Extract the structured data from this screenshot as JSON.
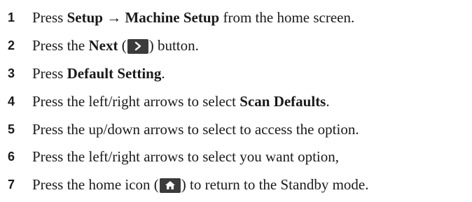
{
  "steps": [
    {
      "number": "1",
      "pre": "Press ",
      "bold1": "Setup",
      "arrow": "→",
      "bold2": "Machine Setup",
      "post": " from the home screen."
    },
    {
      "number": "2",
      "pre": "Press the ",
      "bold": "Next",
      "open": " (",
      "icon": "chevron-right-icon",
      "close": ") button."
    },
    {
      "number": "3",
      "pre": "Press ",
      "bold": "Default Setting",
      "post": "."
    },
    {
      "number": "4",
      "pre": "Press the left/right arrows to select ",
      "bold": "Scan Defaults",
      "post": "."
    },
    {
      "number": "5",
      "text": "Press the up/down arrows to select to access the option."
    },
    {
      "number": "6",
      "text": "Press the left/right arrows to select you want option,"
    },
    {
      "number": "7",
      "pre": "Press the home icon (",
      "icon": "home-icon",
      "post": ") to return to the Standby mode."
    }
  ]
}
